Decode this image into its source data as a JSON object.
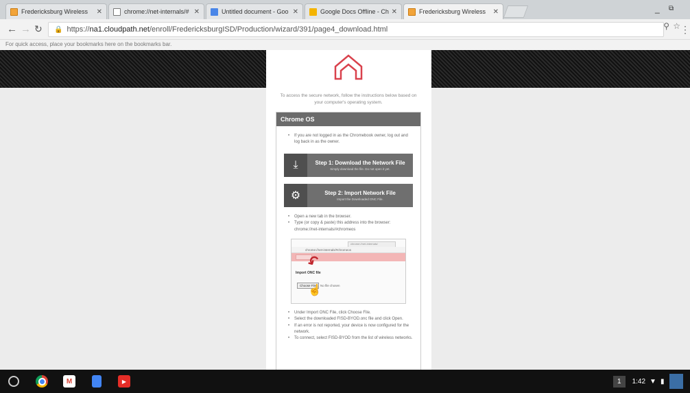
{
  "tabs": [
    {
      "label": "Fredericksburg Wireless",
      "icon": "fredericksburg-favicon",
      "active": false
    },
    {
      "label": "chrome://net-internals/#",
      "icon": "chrome-page-icon",
      "active": false
    },
    {
      "label": "Untitled document - Goo",
      "icon": "docs-icon",
      "active": false
    },
    {
      "label": "Google Docs Offline - Ch",
      "icon": "google-docs-offline-icon",
      "active": false
    },
    {
      "label": "Fredericksburg Wireless",
      "icon": "fredericksburg-favicon",
      "active": true
    }
  ],
  "toolbar": {
    "url_prefix": "https://",
    "url_host": "na1.cloudpath.net",
    "url_path": "/enroll/FredericksburgISD/Production/wizard/391/page4_download.html"
  },
  "bookmarks_hint": "For quick access, place your bookmarks here on the bookmarks bar.",
  "page": {
    "intro": "To access the secure network, follow the instructions below based on your computer's operating system.",
    "panel_title": "Chrome OS",
    "bullet_top": "If you are not logged in as the Chromebook owner, log out and log back in as the owner.",
    "step1_title": "Step 1: Download the Network File",
    "step1_sub": "Simply download the file. Do not open it yet.",
    "step2_title": "Step 2: Import Network File",
    "step2_sub": "Import the Downloaded ONC File.",
    "bullets_mid": [
      "Open a new tab in the browser.",
      "Type (or copy & paste) this address into the browser: chrome://net-internals/#chromeos"
    ],
    "shot_tab": "chrome://net-internals/",
    "shot_url": "chrome://net-internals/#chromeos",
    "shot_import": "Import ONC file",
    "shot_choose": "Choose File",
    "shot_nofile": "No file chosen",
    "bullets_bottom": [
      "Under Import ONC File, click Choose File.",
      "Select the downloaded FISD-BYOD.onc file and click Open.",
      "If an error is not reported, your device is now configured for the network.",
      "To connect, select FISD-BYOD from the list of wireless networks."
    ]
  },
  "taskbar": {
    "apps": [
      "launcher-icon",
      "chrome-icon",
      "gmail-icon",
      "docs-icon",
      "youtube-icon"
    ],
    "notification_count": "1",
    "time": "1:42"
  }
}
